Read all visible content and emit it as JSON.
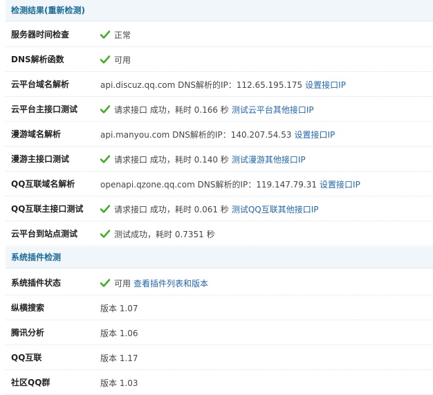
{
  "section1_title": "检测结果(重新检测)",
  "section2_title": "系统插件检测",
  "colors": {
    "check": "#3fae26",
    "link": "#2366a8",
    "header_text": "#1c6b95"
  },
  "rows1": [
    {
      "label": "服务器时间检查",
      "check": true,
      "text": "正常",
      "link": ""
    },
    {
      "label": "DNS解析函数",
      "check": true,
      "text": "可用",
      "link": ""
    },
    {
      "label": "云平台域名解析",
      "check": false,
      "text": "api.discuz.qq.com DNS解析的IP：112.65.195.175",
      "link": "设置接口IP"
    },
    {
      "label": "云平台主接口测试",
      "check": true,
      "text": "请求接口 成功，耗时 0.166 秒",
      "link": "测试云平台其他接口IP"
    },
    {
      "label": "漫游域名解析",
      "check": false,
      "text": "api.manyou.com DNS解析的IP：140.207.54.53",
      "link": "设置接口IP"
    },
    {
      "label": "漫游主接口测试",
      "check": true,
      "text": "请求接口 成功，耗时 0.140 秒",
      "link": "测试漫游其他接口IP"
    },
    {
      "label": "QQ互联域名解析",
      "check": false,
      "text": "openapi.qzone.qq.com DNS解析的IP：119.147.79.31",
      "link": "设置接口IP"
    },
    {
      "label": "QQ互联主接口测试",
      "check": true,
      "text": "请求接口 成功，耗时 0.061 秒",
      "link": "测试QQ互联其他接口IP"
    },
    {
      "label": "云平台到站点测试",
      "check": true,
      "text": "测试成功，耗时 0.7351 秒",
      "link": ""
    }
  ],
  "rows2": [
    {
      "label": "系统插件状态",
      "check": true,
      "text": "可用",
      "link": "查看插件列表和版本"
    },
    {
      "label": "纵横搜索",
      "check": false,
      "text": "版本 1.07",
      "link": ""
    },
    {
      "label": "腾讯分析",
      "check": false,
      "text": "版本 1.06",
      "link": ""
    },
    {
      "label": "QQ互联",
      "check": false,
      "text": "版本 1.17",
      "link": ""
    },
    {
      "label": "社区QQ群",
      "check": false,
      "text": "版本 1.03",
      "link": ""
    }
  ]
}
